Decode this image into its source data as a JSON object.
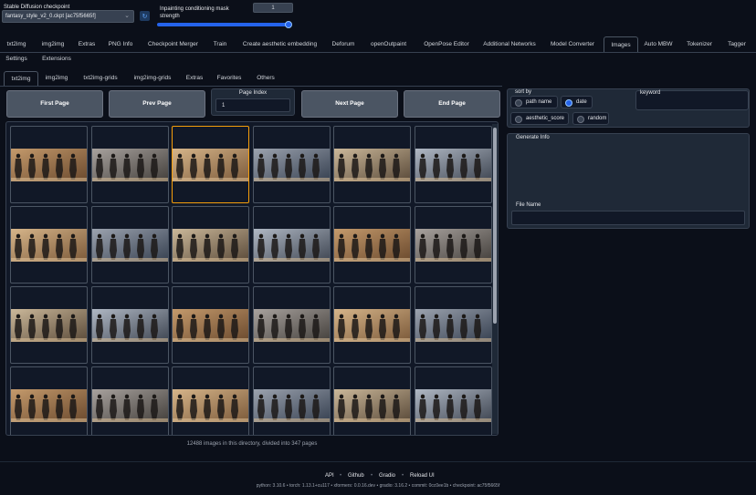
{
  "checkpoint": {
    "label": "Stable Diffusion checkpoint",
    "value": "fantasy_style_v2_0.ckpt [ac75f5665f]"
  },
  "refresh_icon": "refresh-icon",
  "mask_strength": {
    "label_line1": "Inpainting conditioning mask",
    "label_line2": "strength",
    "value": "1",
    "slider_value": 1.0
  },
  "tabs": [
    {
      "label": "txt2img"
    },
    {
      "label": "img2img"
    },
    {
      "label": "Extras"
    },
    {
      "label": "PNG Info"
    },
    {
      "label": "Checkpoint Merger"
    },
    {
      "label": "Train"
    },
    {
      "label": "Create aesthetic embedding"
    },
    {
      "label": "Deforum"
    },
    {
      "label": "openOutpaint"
    },
    {
      "label": "OpenPose Editor"
    },
    {
      "label": "Additional Networks"
    },
    {
      "label": "Model Converter"
    },
    {
      "label": "Images"
    },
    {
      "label": "Auto MBW"
    },
    {
      "label": "Tokenizer"
    },
    {
      "label": "Tagger"
    },
    {
      "label": "Settings"
    },
    {
      "label": "Extensions"
    }
  ],
  "subtabs": [
    {
      "label": "txt2img"
    },
    {
      "label": "img2img"
    },
    {
      "label": "txt2img-grids"
    },
    {
      "label": "img2img-grids"
    },
    {
      "label": "Extras"
    },
    {
      "label": "Favorites"
    },
    {
      "label": "Others"
    }
  ],
  "paging": {
    "first": "First Page",
    "prev": "Prev Page",
    "next": "Next Page",
    "end": "End Page",
    "index_label": "Page Index",
    "index_value": "1"
  },
  "sort": {
    "label": "sort by",
    "options": [
      "path name",
      "date",
      "aesthetic_score",
      "random"
    ],
    "selected": "date"
  },
  "keyword": {
    "label": "keyword",
    "value": ""
  },
  "generate_info": {
    "label": "Generate Info",
    "value": ""
  },
  "file_name": {
    "label": "File Name",
    "value": ""
  },
  "gallery_status": "12488 images in this directory, divided into 347 pages",
  "footer": {
    "links": [
      "API",
      "Github",
      "Gradio",
      "Reload UI"
    ],
    "separator": "•",
    "versions": "python: 3.10.6  •  torch: 1.13.1+cu117  •  xformers: 0.0.16.dev  •  gradio: 3.16.2  •  commit: 0cc0ee1b  •  checkpoint: ac75f5665f"
  },
  "colors": {
    "background": "#0b0f19",
    "panel": "#1f2937",
    "accent": "#2563eb",
    "selected_border": "#f59e0b"
  }
}
